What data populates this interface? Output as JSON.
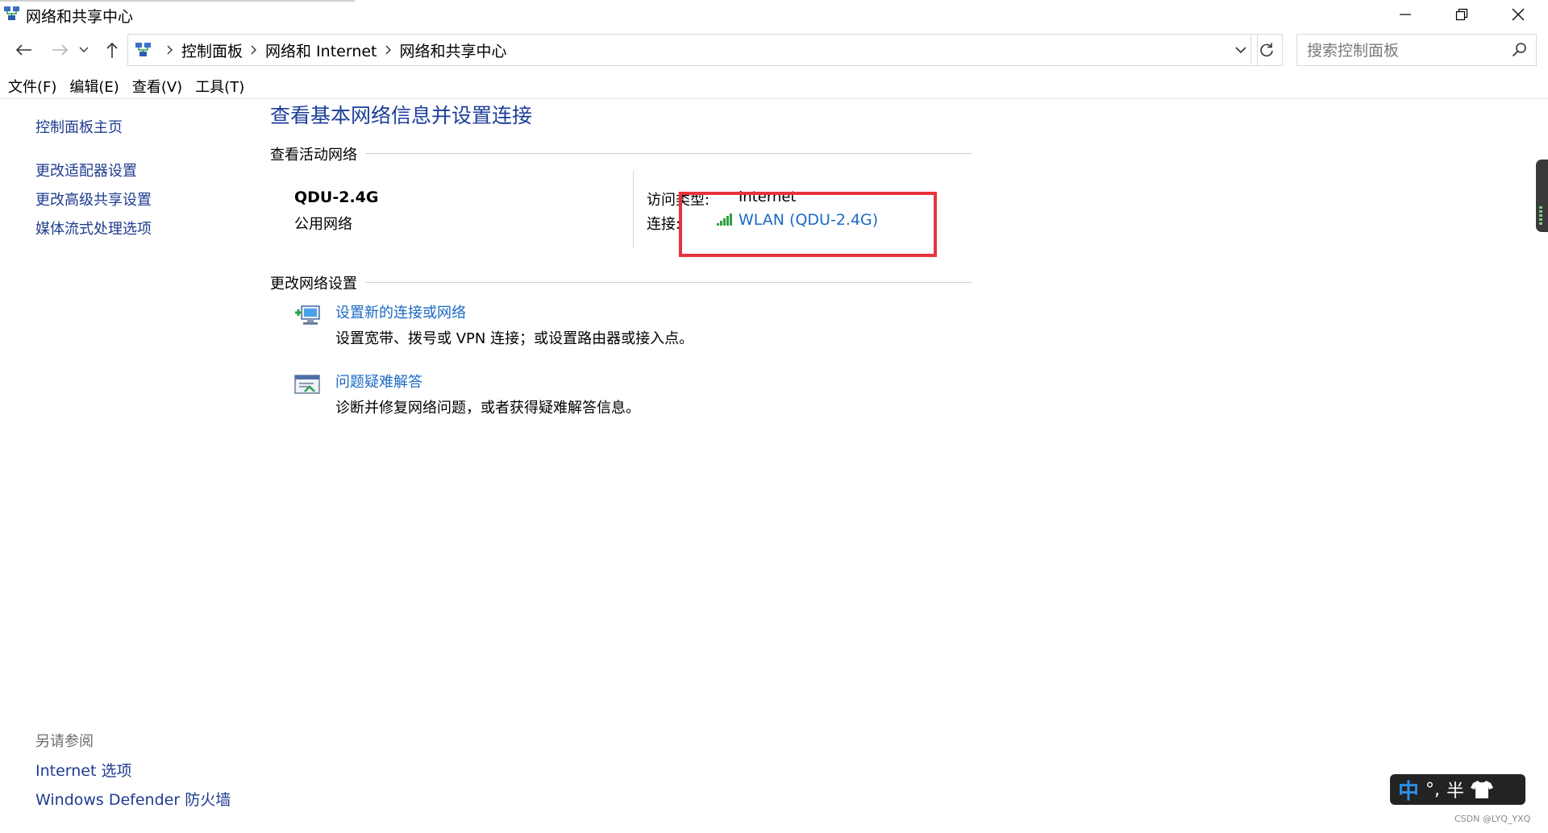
{
  "window": {
    "title": "网络和共享中心"
  },
  "addressbar": {
    "crumbs": [
      "控制面板",
      "网络和 Internet",
      "网络和共享中心"
    ],
    "search_placeholder": "搜索控制面板"
  },
  "menubar": {
    "items": [
      "文件(F)",
      "编辑(E)",
      "查看(V)",
      "工具(T)"
    ]
  },
  "sidebar": {
    "items": [
      "控制面板主页",
      "更改适配器设置",
      "更改高级共享设置",
      "媒体流式处理选项"
    ],
    "see_also_title": "另请参阅",
    "see_also": [
      "Internet 选项",
      "Windows Defender 防火墙"
    ]
  },
  "main": {
    "title": "查看基本网络信息并设置连接",
    "active_section": "查看活动网络",
    "network": {
      "name": "QDU-2.4G",
      "type": "公用网络",
      "access_label": "访问类型:",
      "access_value": "Internet",
      "conn_label": "连接:",
      "conn_value": "WLAN (QDU-2.4G)"
    },
    "change_section": "更改网络设置",
    "tasks": [
      {
        "link": "设置新的连接或网络",
        "desc": "设置宽带、拨号或 VPN 连接；或设置路由器或接入点。"
      },
      {
        "link": "问题疑难解答",
        "desc": "诊断并修复网络问题，或者获得疑难解答信息。"
      }
    ]
  },
  "ime": {
    "mode": "中",
    "punct": "°,",
    "width": "半"
  },
  "watermark": "CSDN @LYQ_YXQ",
  "colors": {
    "link": "#1b6ac4",
    "title": "#1c3e9a",
    "highlight": "#e8323c"
  }
}
